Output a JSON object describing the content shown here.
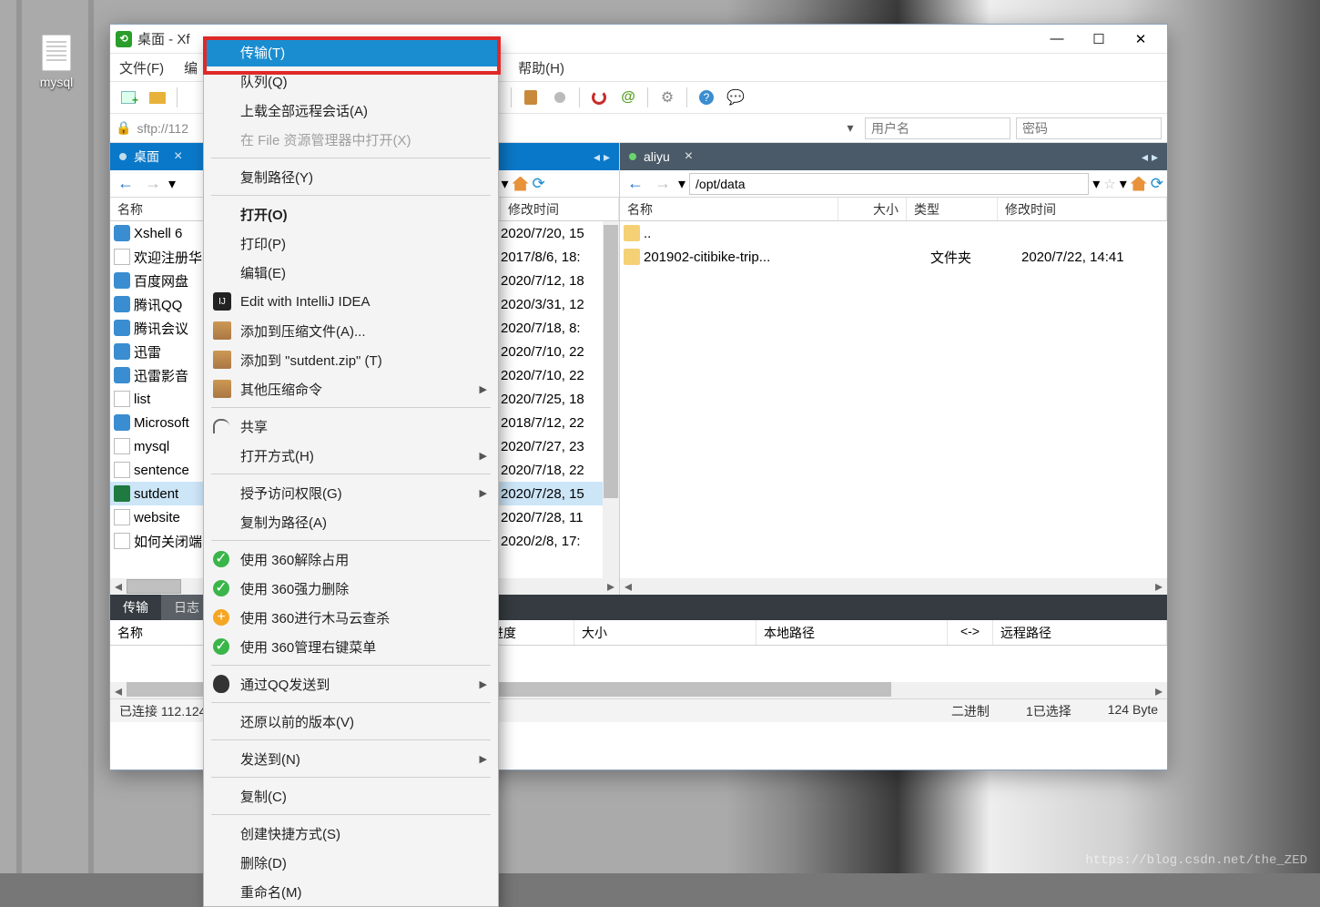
{
  "desktop_icon": {
    "label": "mysql"
  },
  "title": "桌面 - Xf",
  "menubar": [
    "文件(F)",
    "编",
    "帮助(H)"
  ],
  "connbar": {
    "proto": "sftp://112",
    "user_ph": "用户名",
    "pass_ph": "密码"
  },
  "left_panel": {
    "tab": "桌面",
    "columns": {
      "name": "名称",
      "mtime": "修改时间"
    },
    "rows": [
      {
        "name": "Xshell 6",
        "time": "2020/7/20, 15"
      },
      {
        "name": "欢迎注册华",
        "time": "2017/8/6, 18:"
      },
      {
        "name": "百度网盘",
        "time": "2020/7/12, 18"
      },
      {
        "name": "腾讯QQ",
        "time": "2020/3/31, 12"
      },
      {
        "name": "腾讯会议",
        "time": "2020/7/18, 8:"
      },
      {
        "name": "迅雷",
        "time": "2020/7/10, 22"
      },
      {
        "name": "迅雷影音",
        "time": "2020/7/10, 22"
      },
      {
        "name": "list",
        "time": "2020/7/25, 18"
      },
      {
        "name": "Microsoft",
        "time": "2018/7/12, 22"
      },
      {
        "name": "mysql",
        "time": "2020/7/27, 23"
      },
      {
        "name": "sentence",
        "time": "2020/7/18, 22"
      },
      {
        "name": "sutdent",
        "time": "2020/7/28, 15",
        "sel": true
      },
      {
        "name": "website",
        "time": "2020/7/28, 11"
      },
      {
        "name": "如何关闭端",
        "time": "2020/2/8, 17:"
      }
    ]
  },
  "right_panel": {
    "tab": "aliyu",
    "path": "/opt/data",
    "columns": {
      "name": "名称",
      "size": "大小",
      "type": "类型",
      "mtime": "修改时间"
    },
    "rows": [
      {
        "name": "..",
        "size": "",
        "type": "",
        "time": ""
      },
      {
        "name": "201902-citibike-trip...",
        "size": "",
        "type": "文件夹",
        "time": "2020/7/22, 14:41"
      }
    ]
  },
  "context_menu": [
    {
      "label": "传输(T)",
      "hl": true
    },
    {
      "label": "队列(Q)"
    },
    {
      "label": "上载全部远程会话(A)"
    },
    {
      "label": "在 File 资源管理器中打开(X)",
      "dis": true
    },
    {
      "sep": true
    },
    {
      "label": "复制路径(Y)"
    },
    {
      "sep": true
    },
    {
      "label": "打开(O)",
      "bold": true
    },
    {
      "label": "打印(P)"
    },
    {
      "label": "编辑(E)"
    },
    {
      "label": "Edit with IntelliJ IDEA",
      "icon": "ij"
    },
    {
      "label": "添加到压缩文件(A)...",
      "icon": "zip"
    },
    {
      "label": "添加到 \"sutdent.zip\" (T)",
      "icon": "zip"
    },
    {
      "label": "其他压缩命令",
      "icon": "zip",
      "sub": true
    },
    {
      "sep": true
    },
    {
      "label": "共享",
      "icon": "share"
    },
    {
      "label": "打开方式(H)",
      "sub": true
    },
    {
      "sep": true
    },
    {
      "label": "授予访问权限(G)",
      "sub": true
    },
    {
      "label": "复制为路径(A)"
    },
    {
      "sep": true
    },
    {
      "label": "使用 360解除占用",
      "icon": "360"
    },
    {
      "label": "使用 360强力删除",
      "icon": "360"
    },
    {
      "label": "使用 360进行木马云查杀",
      "icon": "360y"
    },
    {
      "label": "使用 360管理右键菜单",
      "icon": "360"
    },
    {
      "sep": true
    },
    {
      "label": "通过QQ发送到",
      "icon": "qq",
      "sub": true
    },
    {
      "sep": true
    },
    {
      "label": "还原以前的版本(V)"
    },
    {
      "sep": true
    },
    {
      "label": "发送到(N)",
      "sub": true
    },
    {
      "sep": true
    },
    {
      "label": "复制(C)"
    },
    {
      "sep": true
    },
    {
      "label": "创建快捷方式(S)"
    },
    {
      "label": "删除(D)"
    },
    {
      "label": "重命名(M)"
    }
  ],
  "transfer_tabs": {
    "active": "传输",
    "other": "日志"
  },
  "transfer_cols": [
    "名称",
    "进度",
    "大小",
    "本地路径",
    "<->",
    "远程路径"
  ],
  "status": {
    "left": "已连接 112.124",
    "mode": "二进制",
    "sel": "1已选择",
    "size": "124 Byte"
  },
  "watermark": "https://blog.csdn.net/the_ZED"
}
